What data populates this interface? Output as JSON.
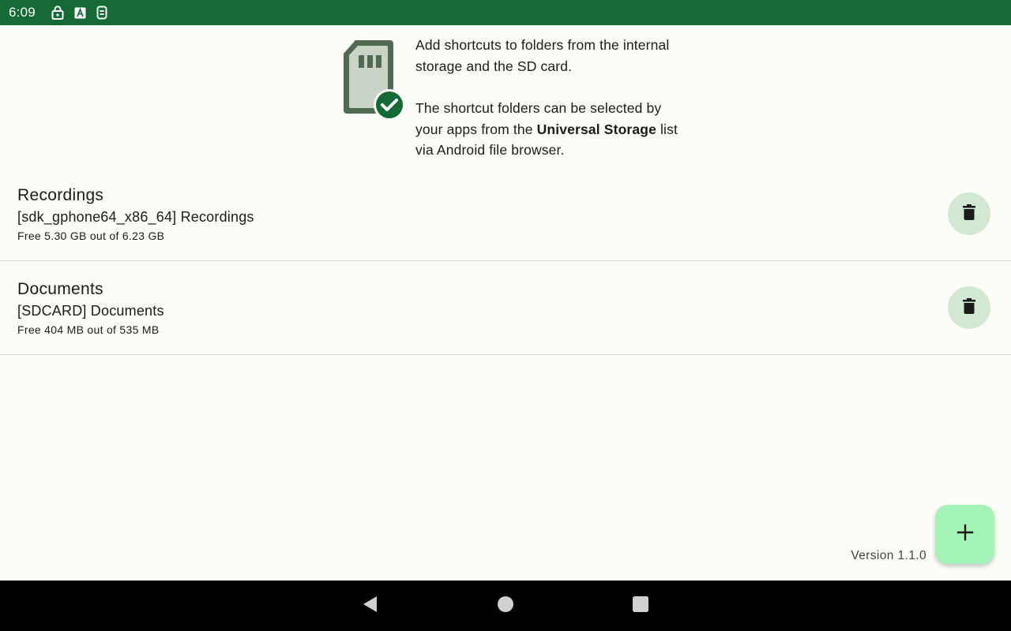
{
  "status_bar": {
    "time": "6:09",
    "icons": [
      "lock-icon",
      "text-a-icon",
      "sim-icon"
    ]
  },
  "header": {
    "icon": "sd-card-check-icon",
    "intro_line1": "Add shortcuts to folders from the internal storage and the SD card.",
    "intro_line2_prefix": "The shortcut folders can be selected by your apps from the ",
    "intro_line2_bold": "Universal Storage",
    "intro_line2_suffix": " list via Android file browser."
  },
  "shortcuts": [
    {
      "title": "Recordings",
      "path": "[sdk_gphone64_x86_64] Recordings",
      "free": "Free 5.30 GB out of 6.23 GB",
      "delete_icon": "trash-icon"
    },
    {
      "title": "Documents",
      "path": "[SDCARD] Documents",
      "free": "Free 404 MB out of 535 MB",
      "delete_icon": "trash-icon"
    }
  ],
  "footer": {
    "version": "Version 1.1.0",
    "fab_icon": "plus-icon"
  },
  "nav": {
    "icons": [
      "back-icon",
      "home-icon",
      "recents-icon"
    ]
  },
  "colors": {
    "status_bar": "#136a34",
    "background": "#fbfdf6",
    "delete_button": "#d3e8d3",
    "fab": "#a4f4b7",
    "accent": "#136a34"
  }
}
